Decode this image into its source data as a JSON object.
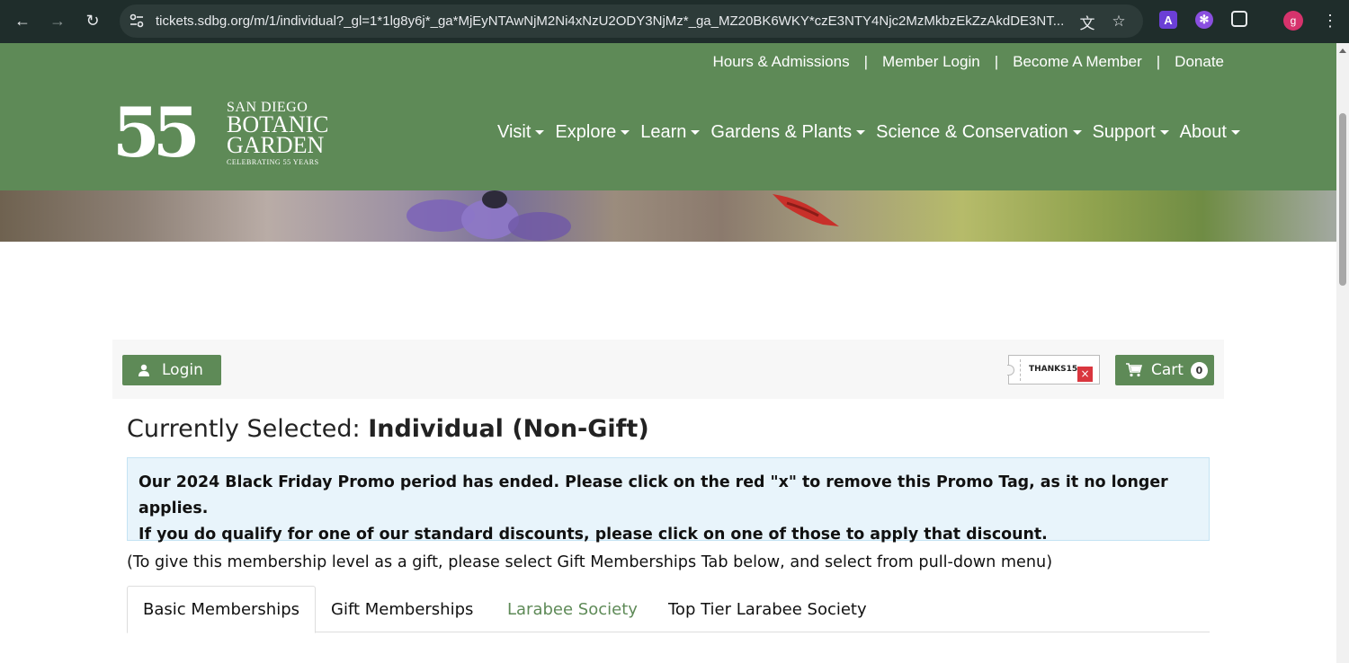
{
  "browser": {
    "url": "tickets.sdbg.org/m/1/individual?_gl=1*1lg8y6j*_ga*MjEyNTAwNjM2Ni4xNzU2ODY3NjMz*_ga_MZ20BK6WKY*czE3NTY4Njc2MzMkbzEkZzAkdDE3NT...",
    "profile_initial": "g",
    "extension_initial": "A"
  },
  "utility_nav": [
    "Hours & Admissions",
    "Member Login",
    "Become A Member",
    "Donate"
  ],
  "logo": {
    "number": "55",
    "line1": "SAN DIEGO",
    "line2": "BOTANIC",
    "line3": "GARDEN",
    "tagline": "CELEBRATING 55 YEARS"
  },
  "main_nav": [
    "Visit",
    "Explore",
    "Learn",
    "Gardens & Plants",
    "Science & Conservation",
    "Support",
    "About"
  ],
  "toolbar": {
    "login_label": "Login",
    "promo_code": "THANKS15",
    "promo_remove": "×",
    "cart_label": "Cart",
    "cart_count": "0"
  },
  "selection": {
    "prefix": "Currently Selected: ",
    "value": "Individual (Non-Gift)"
  },
  "alert": {
    "line1": "Our 2024 Black Friday Promo period has ended. Please click on the red \"x\" to remove this Promo Tag, as it no longer applies.",
    "line2": "If you do qualify for one of our standard discounts, please click on one of those to apply that discount."
  },
  "gift_note": "(To give this membership level as a gift, please select Gift Memberships Tab below, and select from pull-down menu)",
  "tabs": [
    "Basic Memberships",
    "Gift Memberships",
    "Larabee Society",
    "Top Tier Larabee Society"
  ],
  "colors": {
    "brand_green": "#5e8a57",
    "alert_bg": "#e8f4fb",
    "promo_red": "#d9363e"
  }
}
